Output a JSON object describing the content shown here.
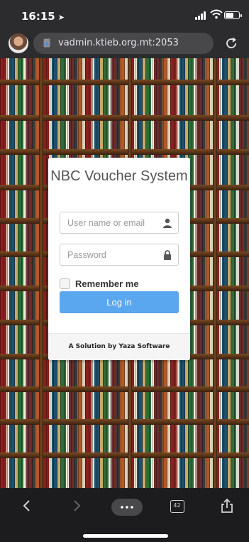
{
  "status_bar": {
    "time": "16:15"
  },
  "browser": {
    "url": "vadmin.ktieb.org.mt:2053",
    "tab_count": "42"
  },
  "login": {
    "title": "NBC Voucher System",
    "username_placeholder": "User name or email",
    "password_placeholder": "Password",
    "remember_label": "Remember me",
    "login_button": "Log in",
    "footer": "A Solution by Yaza Software"
  },
  "colors": {
    "login_button": "#5aa6ef",
    "card_background": "#ffffff",
    "browser_chrome": "#2c2c2e"
  },
  "icons": {
    "user_field": "user-icon",
    "password_field": "lock-icon",
    "reload": "reload-icon",
    "back": "chevron-left-icon",
    "forward": "chevron-right-icon",
    "more": "more-icon",
    "tabs": "tabs-icon",
    "share": "share-icon"
  }
}
